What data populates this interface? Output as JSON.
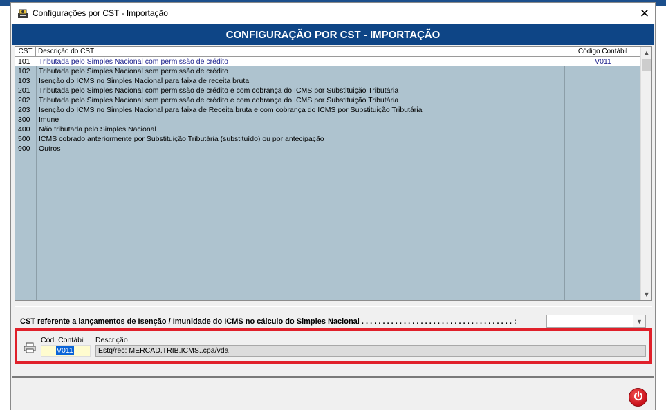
{
  "window": {
    "title": "Configurações por CST - Importação",
    "close_glyph": "✕",
    "header": "CONFIGURAÇÃO POR CST - IMPORTAÇÃO"
  },
  "grid": {
    "columns": {
      "cst": "CST",
      "descricao": "Descrição do CST",
      "codigo": "Código Contábil"
    },
    "rows": [
      {
        "cst": "101",
        "descricao": "Tributada pelo Simples Nacional com permissão de crédito",
        "codigo": "V011"
      },
      {
        "cst": "102",
        "descricao": "Tributada pelo Simples Nacional sem permissão de crédito",
        "codigo": ""
      },
      {
        "cst": "103",
        "descricao": "Isenção do ICMS no Simples Nacional para faixa de receita bruta",
        "codigo": ""
      },
      {
        "cst": "201",
        "descricao": "Tributada pelo Simples Nacional com permissão de crédito e com cobrança do ICMS por Substituição Tributária",
        "codigo": ""
      },
      {
        "cst": "202",
        "descricao": "Tributada pelo Simples Nacional sem permissão de crédito e com cobrança do ICMS por Substituição Tributária",
        "codigo": ""
      },
      {
        "cst": "203",
        "descricao": "Isenção do ICMS no Simples Nacional para faixa de Receita bruta e com cobrança do ICMS por Substituição Tributária",
        "codigo": ""
      },
      {
        "cst": "300",
        "descricao": "Imune",
        "codigo": ""
      },
      {
        "cst": "400",
        "descricao": "Não tributada pelo Simples Nacional",
        "codigo": ""
      },
      {
        "cst": "500",
        "descricao": "ICMS cobrado anteriormente por Substituição Tributária (substituído) ou por antecipação",
        "codigo": ""
      },
      {
        "cst": "900",
        "descricao": "Outros",
        "codigo": ""
      }
    ],
    "selected_row": 0
  },
  "cst_isencao": {
    "label": "CST referente a lançamentos de Isenção / Imunidade do ICMS no cálculo do Simples Nacional . . . . . . . . . . . . . . . . . . . . . . . . . . . . . . . . . . . . :",
    "value": ""
  },
  "detail": {
    "cod_label": "Cód. Contábil",
    "cod_value": "V011",
    "desc_label": "Descrição",
    "desc_value": "Estq/rec: MERCAD.TRIB.ICMS..cpa/vda"
  },
  "colors": {
    "header_band": "#0e4586",
    "grid_background": "#aec3cf",
    "highlight_border": "#e0202a",
    "power_button": "#c8101a"
  }
}
